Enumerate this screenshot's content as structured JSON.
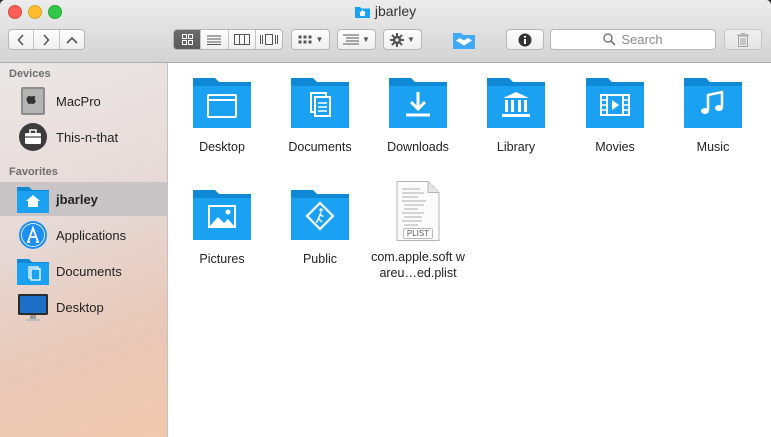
{
  "window": {
    "title": "jbarley"
  },
  "toolbar": {
    "back_label": "<",
    "forward_label": ">",
    "search_placeholder": "Search"
  },
  "sidebar": {
    "devices_header": "Devices",
    "devices": [
      {
        "label": "MacPro",
        "icon": "mac-pro-icon"
      },
      {
        "label": "This-n-that",
        "icon": "briefcase-icon"
      }
    ],
    "favorites_header": "Favorites",
    "favorites": [
      {
        "label": "jbarley",
        "icon": "home-folder-icon",
        "selected": true
      },
      {
        "label": "Applications",
        "icon": "applications-icon"
      },
      {
        "label": "Documents",
        "icon": "documents-folder-icon"
      },
      {
        "label": "Desktop",
        "icon": "desktop-icon"
      }
    ]
  },
  "files": [
    {
      "label": "Desktop",
      "icon": "desktop-folder-icon"
    },
    {
      "label": "Documents",
      "icon": "documents-folder-icon"
    },
    {
      "label": "Downloads",
      "icon": "downloads-folder-icon"
    },
    {
      "label": "Library",
      "icon": "library-folder-icon"
    },
    {
      "label": "Movies",
      "icon": "movies-folder-icon"
    },
    {
      "label": "Music",
      "icon": "music-folder-icon"
    },
    {
      "label": "Pictures",
      "icon": "pictures-folder-icon"
    },
    {
      "label": "Public",
      "icon": "public-folder-icon"
    },
    {
      "label": "com.apple.soft wareu…ed.plist",
      "icon": "plist-file-icon",
      "badge": "PLIST"
    }
  ],
  "colors": {
    "folder": "#1ba1f2",
    "folder_dark": "#0f89d6",
    "selection": "#c9c4c6"
  }
}
